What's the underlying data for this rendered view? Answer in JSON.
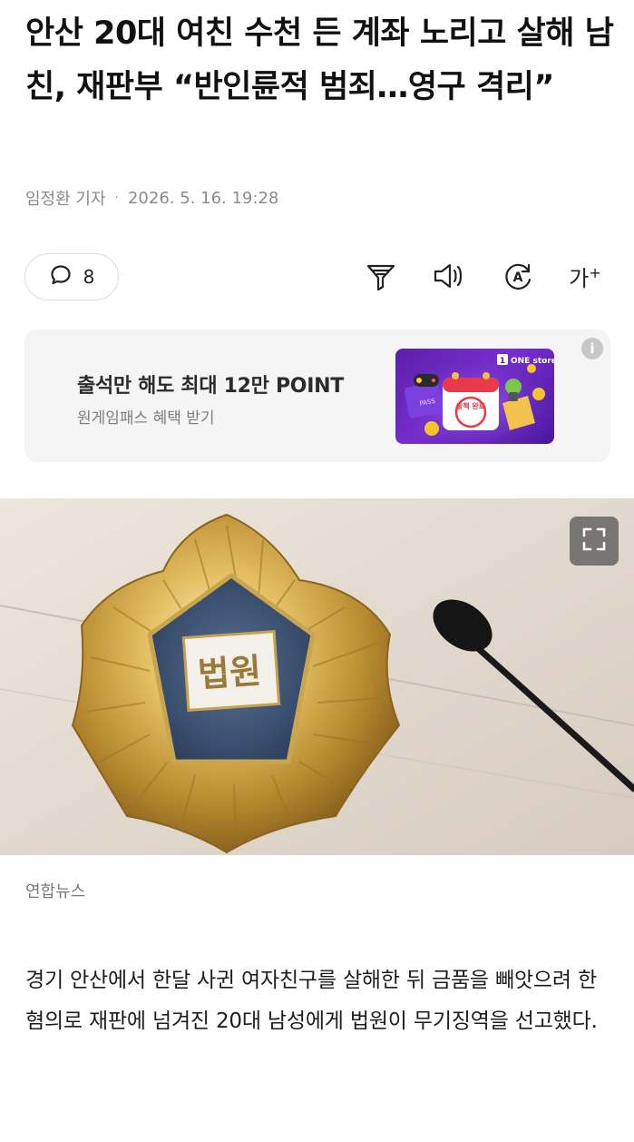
{
  "article": {
    "headline": "안산 20대 여친 수천 든 계좌 노리고 살해 남친, 재판부 “반인륜적 범죄…영구 격리”",
    "reporter": "임정환 기자",
    "datetime": "2026. 5. 16. 19:28",
    "comment_count": "8",
    "photo_caption": "연합뉴스",
    "body": "경기 안산에서 한달 사귄 여자친구를 살해한 뒤 금품을 빼앗으려 한 혐의로 재판에 넘겨진 20대 남성에게 법원이 무기징역을 선고했다."
  },
  "toolbar": {
    "icons": [
      "comment-icon",
      "summary-icon",
      "speaker-icon",
      "translate-icon",
      "font-size-icon"
    ],
    "font_size_label": "가",
    "font_size_plus": "+",
    "translate_glyph": "A"
  },
  "ad": {
    "title": "출석만 해도 최대 12만 POINT",
    "subtitle": "원게임패스 혜택 받기",
    "info_glyph": "i",
    "image_brand": "ONE store",
    "image_brand_mark": "1",
    "image_stamp": "출첵 완료",
    "image_pass": "PASS"
  },
  "photo": {
    "sign_text": "법원"
  },
  "colors": {
    "text_primary": "#111111",
    "text_secondary": "#8a8a8a",
    "ad_bg": "#f5f5f6",
    "ad_image_purple": "#6a25c0",
    "emblem_gold": "#c9a24a",
    "emblem_blue": "#3f5675"
  }
}
